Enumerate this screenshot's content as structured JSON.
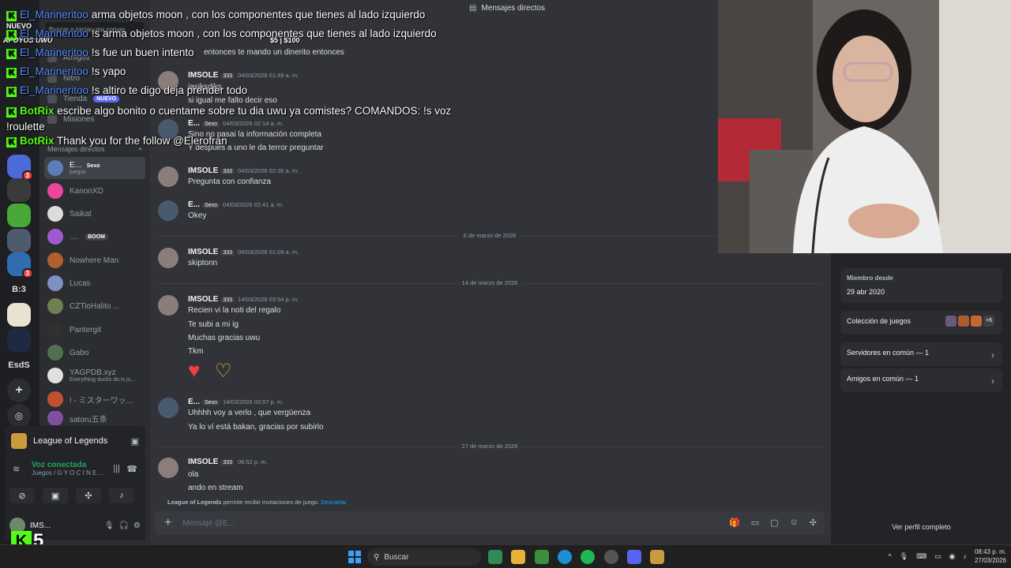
{
  "topbar": {
    "title": "Mensajes directos"
  },
  "sidebar": {
    "search_placeholder": "Buscar o iniciar una conver",
    "nav": [
      {
        "label": "Amigos"
      },
      {
        "label": "Nitro"
      },
      {
        "label": "Tienda",
        "badge": "NUEVO"
      },
      {
        "label": "Misiones"
      }
    ],
    "dm_header": "Mensajes directos",
    "dm_add": "+",
    "dms": [
      {
        "name": "E...",
        "tag": "Sexo",
        "sub": "juegos",
        "color": "#5b7db8",
        "active": true
      },
      {
        "name": "KanonXD",
        "color": "#eb459e"
      },
      {
        "name": "Saikat",
        "color": "#dcdcdc"
      },
      {
        "name": "....",
        "sub_tag": "BOOM",
        "color": "#a05ad0"
      },
      {
        "name": "Nowhere Man",
        "color": "#b06030"
      },
      {
        "name": "Lucas",
        "color": "#8090c0"
      },
      {
        "name": "CZTioHalito ...",
        "color": "#708050"
      },
      {
        "name": "Pantergit",
        "color": "#303030"
      },
      {
        "name": "Gabo",
        "color": "#507050"
      },
      {
        "name": "YAGPDB.xyz",
        "sub": "Everything ducks do is ju...",
        "color": "#e0e0e0"
      },
      {
        "name": "! - ミスターワッ...",
        "color": "#c05030"
      },
      {
        "name": "satoru五条",
        "color": "#8050a0"
      }
    ],
    "activity": {
      "game": "League of Legends"
    },
    "voice": {
      "status": "Voz conectada",
      "channel": "Juegos / G Y O C I N E ..."
    },
    "user": {
      "name": "IMS..."
    }
  },
  "rail": {
    "servers": [
      "B:3",
      "EsdS",
      "+"
    ]
  },
  "chat": {
    "messages": [
      {
        "author": "",
        "lines": [
          "entonces te mando un dinerito entonces"
        ]
      },
      {
        "author": "IMSOLE",
        "tag": "333",
        "time": "04/03/2026 01:49 a. m.",
        "lines": [
          "jasiksdjks",
          "si igual me falto decir eso"
        ]
      },
      {
        "author": "E...",
        "tag": "Sexo",
        "time": "04/03/2026 02:14 a. m.",
        "lines": [
          "Sino no pasai la información completa",
          "Y después a uno le da terror preguntar"
        ]
      },
      {
        "author": "IMSOLE",
        "tag": "333",
        "time": "04/03/2026 02:35 a. m.",
        "lines": [
          "Pregunta con confianza"
        ]
      },
      {
        "author": "E...",
        "tag": "Sexo",
        "time": "04/03/2026 02:41 a. m.",
        "lines": [
          "Okey"
        ]
      },
      {
        "author": "IMSOLE",
        "tag": "333",
        "time": "06/03/2026 01:09 a. m.",
        "lines": [
          "skiptonn"
        ]
      },
      {
        "author": "IMSOLE",
        "tag": "333",
        "time": "14/03/2026 03:54 p. m.",
        "lines": [
          "Recien vi la noti del regalo",
          "Te subi a mi ig",
          "Muchas gracias uwu",
          "Tkm"
        ]
      },
      {
        "author": "E...",
        "tag": "Sexo",
        "time": "14/03/2026 03:57 p. m.",
        "lines": [
          "Uhhhh voy a verlo , que vergüenza",
          "Ya lo ví está bakan, gracias por subirlo"
        ]
      },
      {
        "author": "IMSOLE",
        "tag": "333",
        "time": "06:52 p. m.",
        "lines": [
          "ola",
          "ando en stream"
        ]
      }
    ],
    "dividers": [
      "6 de marzo de 2026",
      "14 de marzo de 2026",
      "27 de marzo de 2026"
    ],
    "notice": {
      "game": "League of Legends",
      "text": "permite recibir invitaciones de juego.",
      "link": "Descartar"
    },
    "composer_placeholder": "Mensaje @E..."
  },
  "profile": {
    "member_since_label": "Miembro desde",
    "member_since": "29 abr 2020",
    "games_label": "Colección de juegos",
    "games_more": "+6",
    "servers_common": "Servidores en común — 1",
    "friends_common": "Amigos en común — 1",
    "view_full": "Ver perfil completo"
  },
  "stream_overlay": {
    "money": "$5 | $100",
    "lines": [
      {
        "user": "El_Marineritoo",
        "text": "arma objetos moon , con los componentes que tienes al lado izquierdo",
        "bot": false
      },
      {
        "user": "El_Marineritoo",
        "text": "!s arma objetos moon , con los componentes que tienes al lado izquierdo",
        "bot": false
      },
      {
        "user": "El_Marineritoo",
        "text": "!s fue un buen intento",
        "bot": false
      },
      {
        "user": "El_Marineritoo",
        "text": "!s yapo",
        "bot": false
      },
      {
        "user": "El_Marineritoo",
        "text": "!s altiro te digo deja prender todo",
        "bot": false
      },
      {
        "user": "BotRix",
        "text": "escribe algo bonito o cuentame sobre tu dia uwu ya comistes? COMANDOS: !s voz !roulette",
        "bot": true
      },
      {
        "user": "BotRix",
        "text": "Thank you for the follow @Elerofran",
        "bot": true
      }
    ],
    "kick_count": "5",
    "left_labels": [
      "NUEVO",
      "APOYOS UWU"
    ]
  },
  "taskbar": {
    "search": "Buscar",
    "time": "08:43 p. m.",
    "date": "27/03/2026"
  },
  "colors": {
    "accent": "#5865f2",
    "online": "#23a55a",
    "kick": "#53fc18",
    "danger": "#f23f43"
  }
}
